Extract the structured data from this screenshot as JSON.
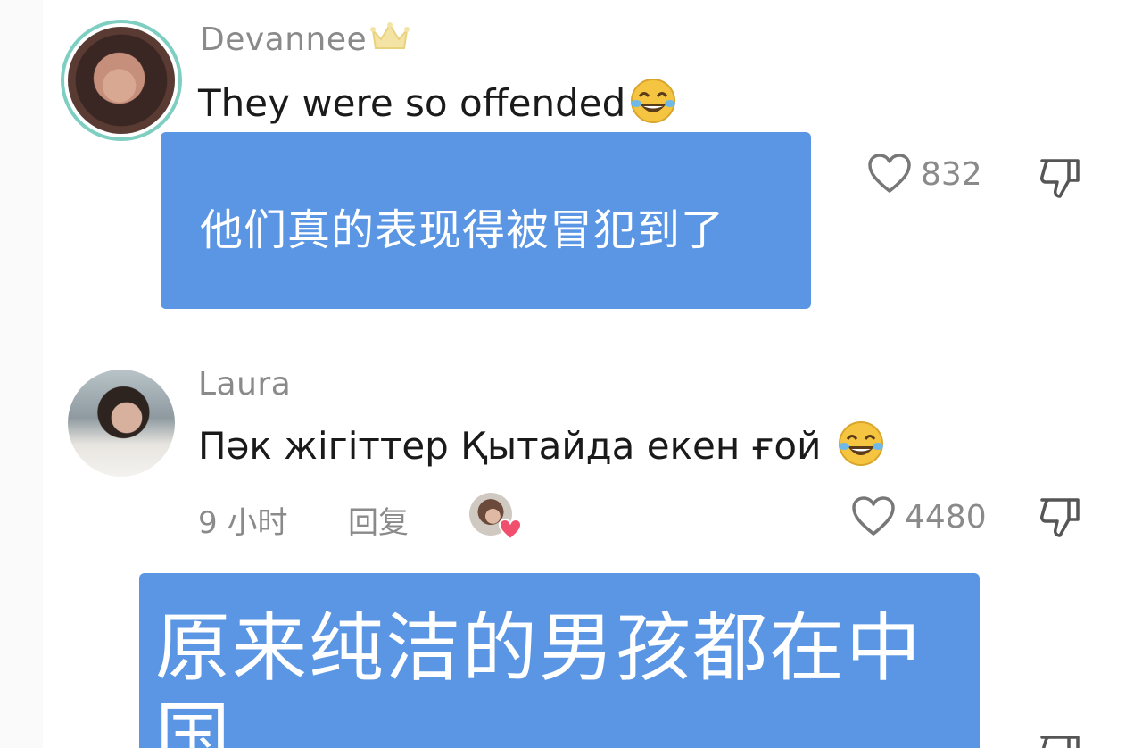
{
  "comments": [
    {
      "username": "Devannee",
      "text": "They were so offended",
      "translation": "他们真的表现得被冒犯到了",
      "likes": "832"
    },
    {
      "username": "Laura",
      "text": "Пәк жігіттер Қытайда екен ғой ",
      "time": "9 小时",
      "reply_label": "回复",
      "likes": "4480",
      "translation": "原来纯洁的男孩都在中国"
    }
  ],
  "icons": {
    "crown": "crown-icon",
    "laughing_emoji": "laughing-tears-emoji",
    "heart": "heart-outline-icon",
    "dislike": "thumbs-down-icon"
  },
  "colors": {
    "translation_box": "#5a96e3",
    "avatar_ring": "#7ecfc2",
    "muted_text": "#8a8a8a"
  }
}
